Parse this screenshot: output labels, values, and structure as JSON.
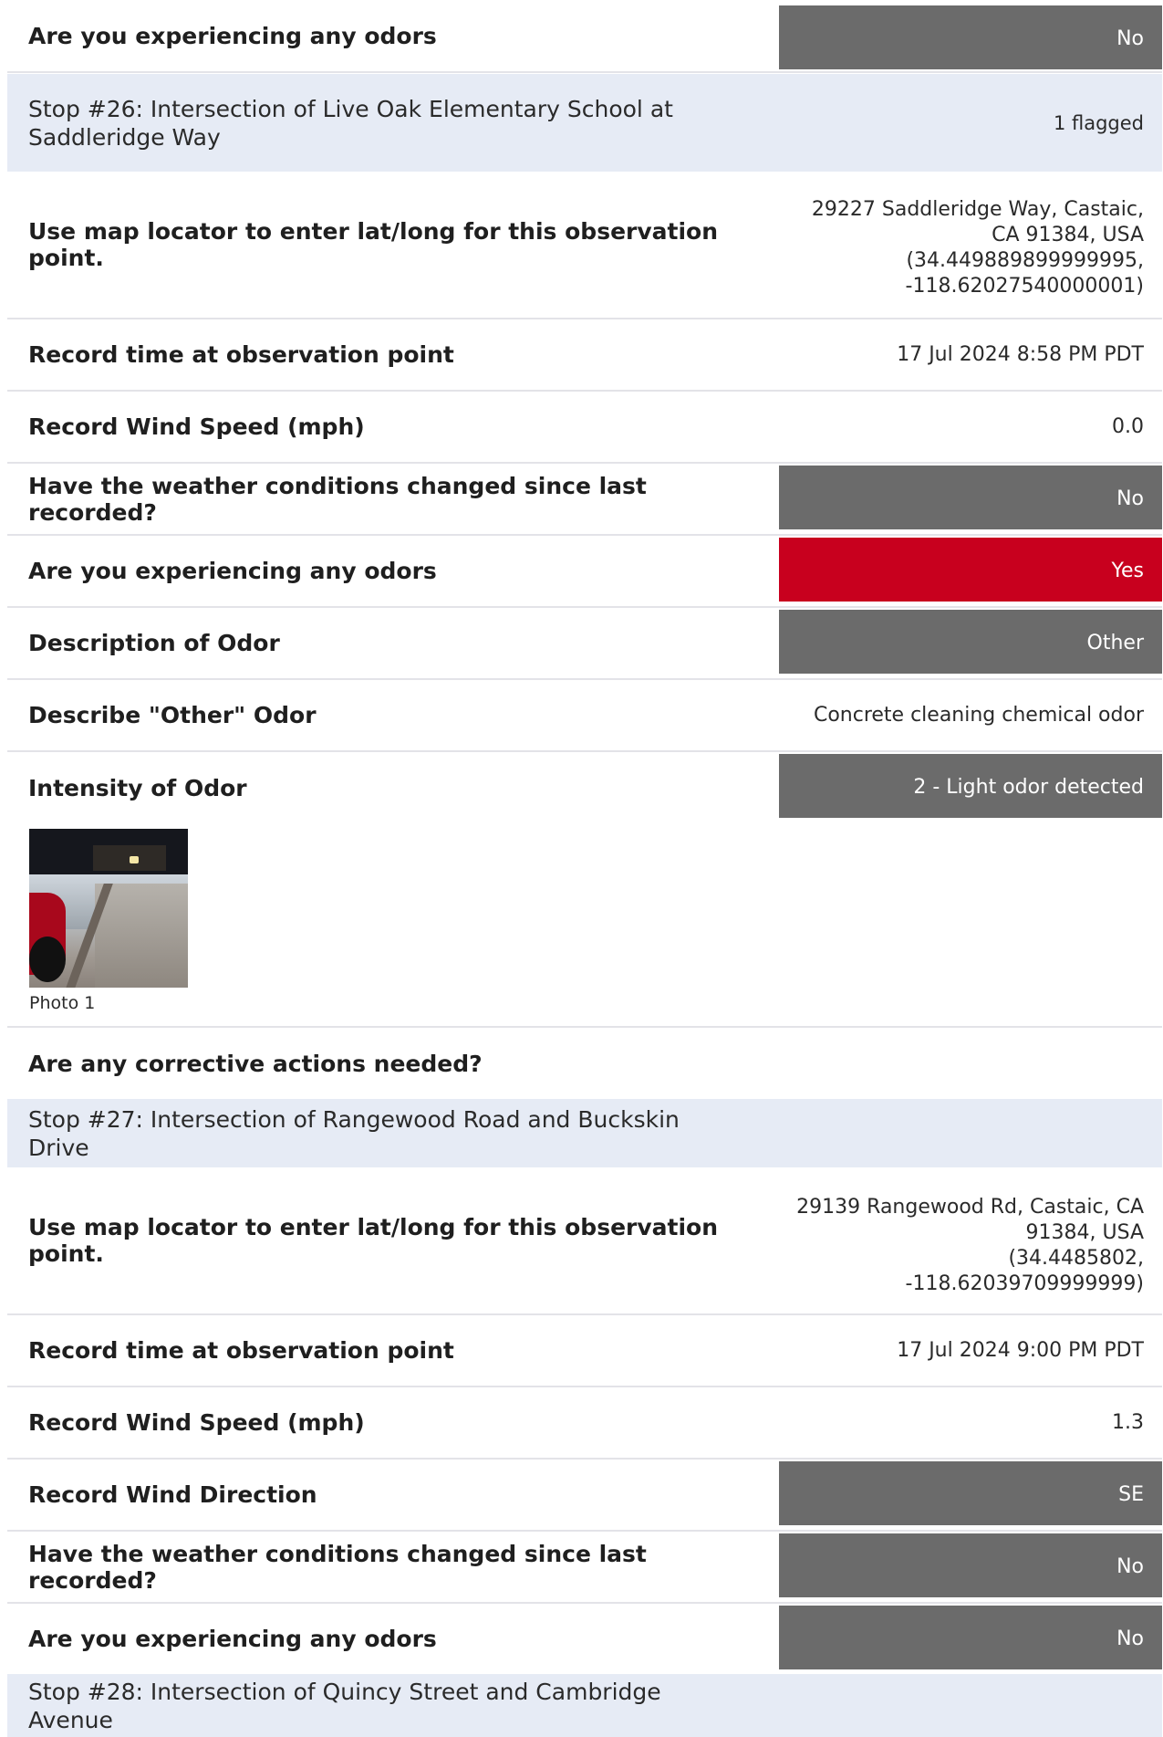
{
  "rows": {
    "r1": {
      "label": "Are you experiencing any odors",
      "value": "No"
    },
    "stop26": {
      "title": "Stop #26: Intersection of Live Oak Elementary School at Saddleridge Way",
      "flagged": "1 flagged"
    },
    "r2": {
      "label": "Use map locator to enter lat/long for this observation point.",
      "address": "29227 Saddleridge Way, Castaic, CA 91384, USA",
      "coords": "(34.449889899999995, -118.62027540000001)"
    },
    "r3": {
      "label": "Record time at observation point",
      "value": "17 Jul 2024 8:58 PM PDT"
    },
    "r4": {
      "label": "Record Wind Speed (mph)",
      "value": "0.0"
    },
    "r5": {
      "label": "Have the weather conditions changed since last recorded?",
      "value": "No"
    },
    "r6": {
      "label": "Are you experiencing any odors",
      "value": "Yes"
    },
    "r7": {
      "label": "Description of Odor",
      "value": "Other"
    },
    "r8": {
      "label": "Describe \"Other\" Odor",
      "value": "Concrete cleaning chemical odor"
    },
    "r9": {
      "label": "Intensity of Odor",
      "value": "2 - Light odor detected",
      "photo_caption": "Photo 1"
    },
    "r10": {
      "label": "Are any corrective actions needed?"
    },
    "stop27": {
      "title": "Stop #27: Intersection of Rangewood Road and Buckskin Drive"
    },
    "r11": {
      "label": "Use map locator to enter lat/long for this observation point.",
      "address": "29139 Rangewood Rd, Castaic, CA 91384, USA",
      "coords": "(34.4485802, -118.62039709999999)"
    },
    "r12": {
      "label": "Record time at observation point",
      "value": "17 Jul 2024 9:00 PM PDT"
    },
    "r13": {
      "label": "Record Wind Speed (mph)",
      "value": "1.3"
    },
    "r14": {
      "label": "Record Wind Direction",
      "value": "SE"
    },
    "r15": {
      "label": "Have the weather conditions changed since last recorded?",
      "value": "No"
    },
    "r16": {
      "label": "Are you experiencing any odors",
      "value": "No"
    },
    "stop28": {
      "title": "Stop #28: Intersection of Quincy Street and Cambridge Avenue"
    }
  },
  "colors": {
    "neutral_box": "#6b6b6b",
    "flag_red": "#c8001e",
    "stop_header_bg": "#e6ebf5"
  },
  "icons": {
    "photo": "site-photo"
  }
}
